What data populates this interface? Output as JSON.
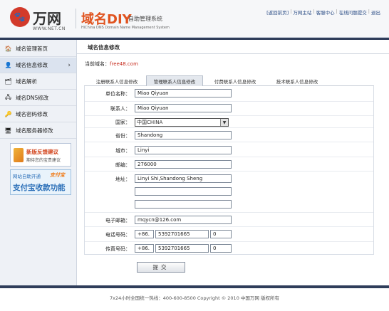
{
  "header": {
    "logo_badge": "🐾",
    "logo_name": "万网",
    "logo_url": "WWW.NET.CN",
    "system_title": "域名DIY",
    "system_subtitle": "自助管理系统",
    "system_title_en": "HiChina DNS Domain Name Management System",
    "links": [
      "[返回前页]",
      "万网主站",
      "客服中心",
      "在线问题提交",
      "退出"
    ]
  },
  "sidebar": {
    "items": [
      {
        "label": "域名管理首页",
        "icon": "home-icon"
      },
      {
        "label": "域名信息修改",
        "icon": "user-edit-icon"
      },
      {
        "label": "域名解析",
        "icon": "dns-icon"
      },
      {
        "label": "域名DNS修改",
        "icon": "server-icon"
      },
      {
        "label": "域名密码修改",
        "icon": "key-icon"
      },
      {
        "label": "域名服务器修改",
        "icon": "computer-icon"
      }
    ],
    "promo_feedback_title": "新版反馈建议",
    "promo_feedback_sub": "期待您的宝贵建议",
    "promo_alipay_top": "网站自助开通",
    "promo_alipay_brand": "支付宝",
    "promo_alipay_main": "支付宝收款功能"
  },
  "main": {
    "title": "域名信息修改",
    "current_domain_label": "当前域名：",
    "current_domain": "free48.com",
    "tabs": [
      "注册联系人信息修改",
      "管理联系人信息修改",
      "付费联系人信息修改",
      "技术联系人信息修改"
    ],
    "active_tab": 1
  },
  "form": {
    "org_label": "单位名称：",
    "org_value": "Miao Qiyuan",
    "contact_label": "联系人：",
    "contact_value": "Miao Qiyuan",
    "country_label": "国家：",
    "country_value": "中国CHINA",
    "province_label": "省份：",
    "province_value": "Shandong",
    "city_label": "城市：",
    "city_value": "Linyi",
    "zip_label": "邮编：",
    "zip_value": "276000",
    "address_label": "地址：",
    "address_line1": "Linyi Shi,Shandong Sheng",
    "address_line2": "",
    "address_line3": "",
    "email_label": "电子邮箱：",
    "email_value": "mqycn@126.com",
    "phone_label": "电话号码：",
    "phone_cc": "+86.",
    "phone_num": "5392701665",
    "phone_ext": "0",
    "fax_label": "传真号码：",
    "fax_cc": "+86.",
    "fax_num": "5392701665",
    "fax_ext": "0",
    "submit_label": "提交"
  },
  "footer": {
    "text": "7x24小时全国统一热线：400-600-8500      Copyright © 2010 中国万网 版权所有"
  }
}
